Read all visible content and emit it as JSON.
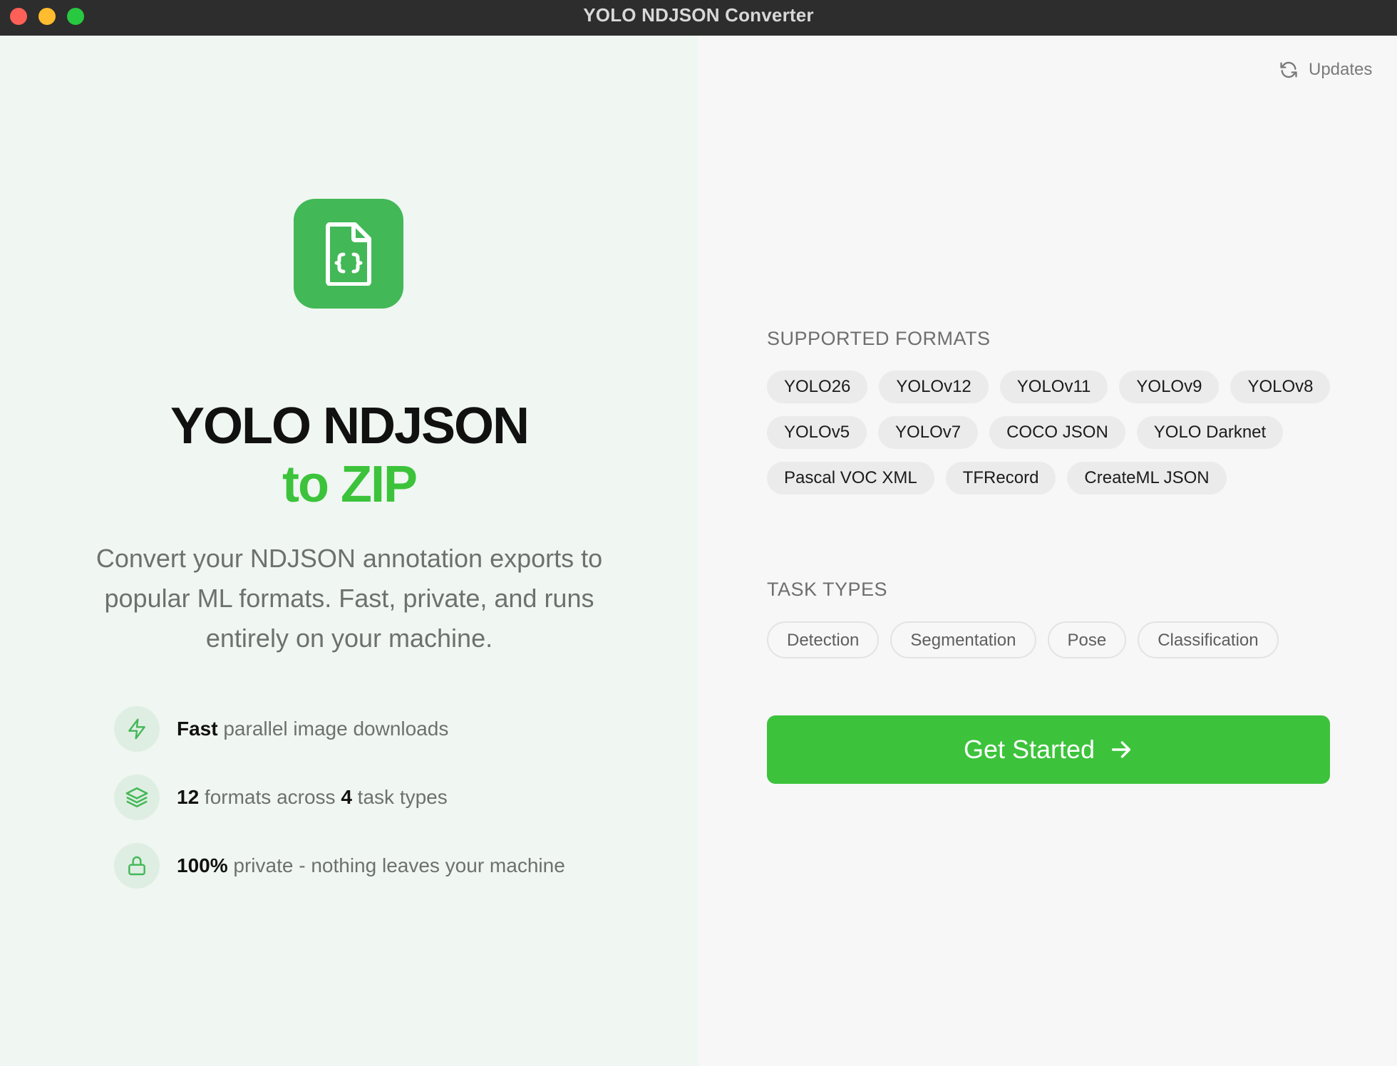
{
  "window": {
    "title": "YOLO NDJSON Converter"
  },
  "hero": {
    "title_line1": "YOLO NDJSON",
    "title_line2": "to ZIP",
    "description": "Convert your NDJSON annotation exports to popular ML formats. Fast, private, and runs entirely on your machine.",
    "icon": "file-json-icon"
  },
  "features": [
    {
      "icon": "lightning-icon",
      "parts": [
        {
          "t": "Fast",
          "b": true
        },
        {
          "t": " parallel image downloads",
          "b": false
        }
      ]
    },
    {
      "icon": "layers-icon",
      "parts": [
        {
          "t": "12",
          "b": true
        },
        {
          "t": " formats across ",
          "b": false
        },
        {
          "t": "4",
          "b": true
        },
        {
          "t": " task types",
          "b": false
        }
      ]
    },
    {
      "icon": "lock-icon",
      "parts": [
        {
          "t": "100%",
          "b": true
        },
        {
          "t": " private - nothing leaves your machine",
          "b": false
        }
      ]
    }
  ],
  "updates": {
    "label": "Updates",
    "icon": "refresh-icon"
  },
  "formats": {
    "label": "SUPPORTED FORMATS",
    "items": [
      "YOLO26",
      "YOLOv12",
      "YOLOv11",
      "YOLOv9",
      "YOLOv8",
      "YOLOv5",
      "YOLOv7",
      "COCO JSON",
      "YOLO Darknet",
      "Pascal VOC XML",
      "TFRecord",
      "CreateML JSON"
    ]
  },
  "tasks": {
    "label": "TASK TYPES",
    "items": [
      "Detection",
      "Segmentation",
      "Pose",
      "Classification"
    ]
  },
  "cta": {
    "label": "Get Started",
    "icon": "arrow-right-icon"
  },
  "colors": {
    "accent": "#3cc33b",
    "icon_green": "#42b857",
    "left_bg": "#f0f6f1",
    "right_bg": "#f7f7f7",
    "titlebar": "#2d2d2d"
  }
}
